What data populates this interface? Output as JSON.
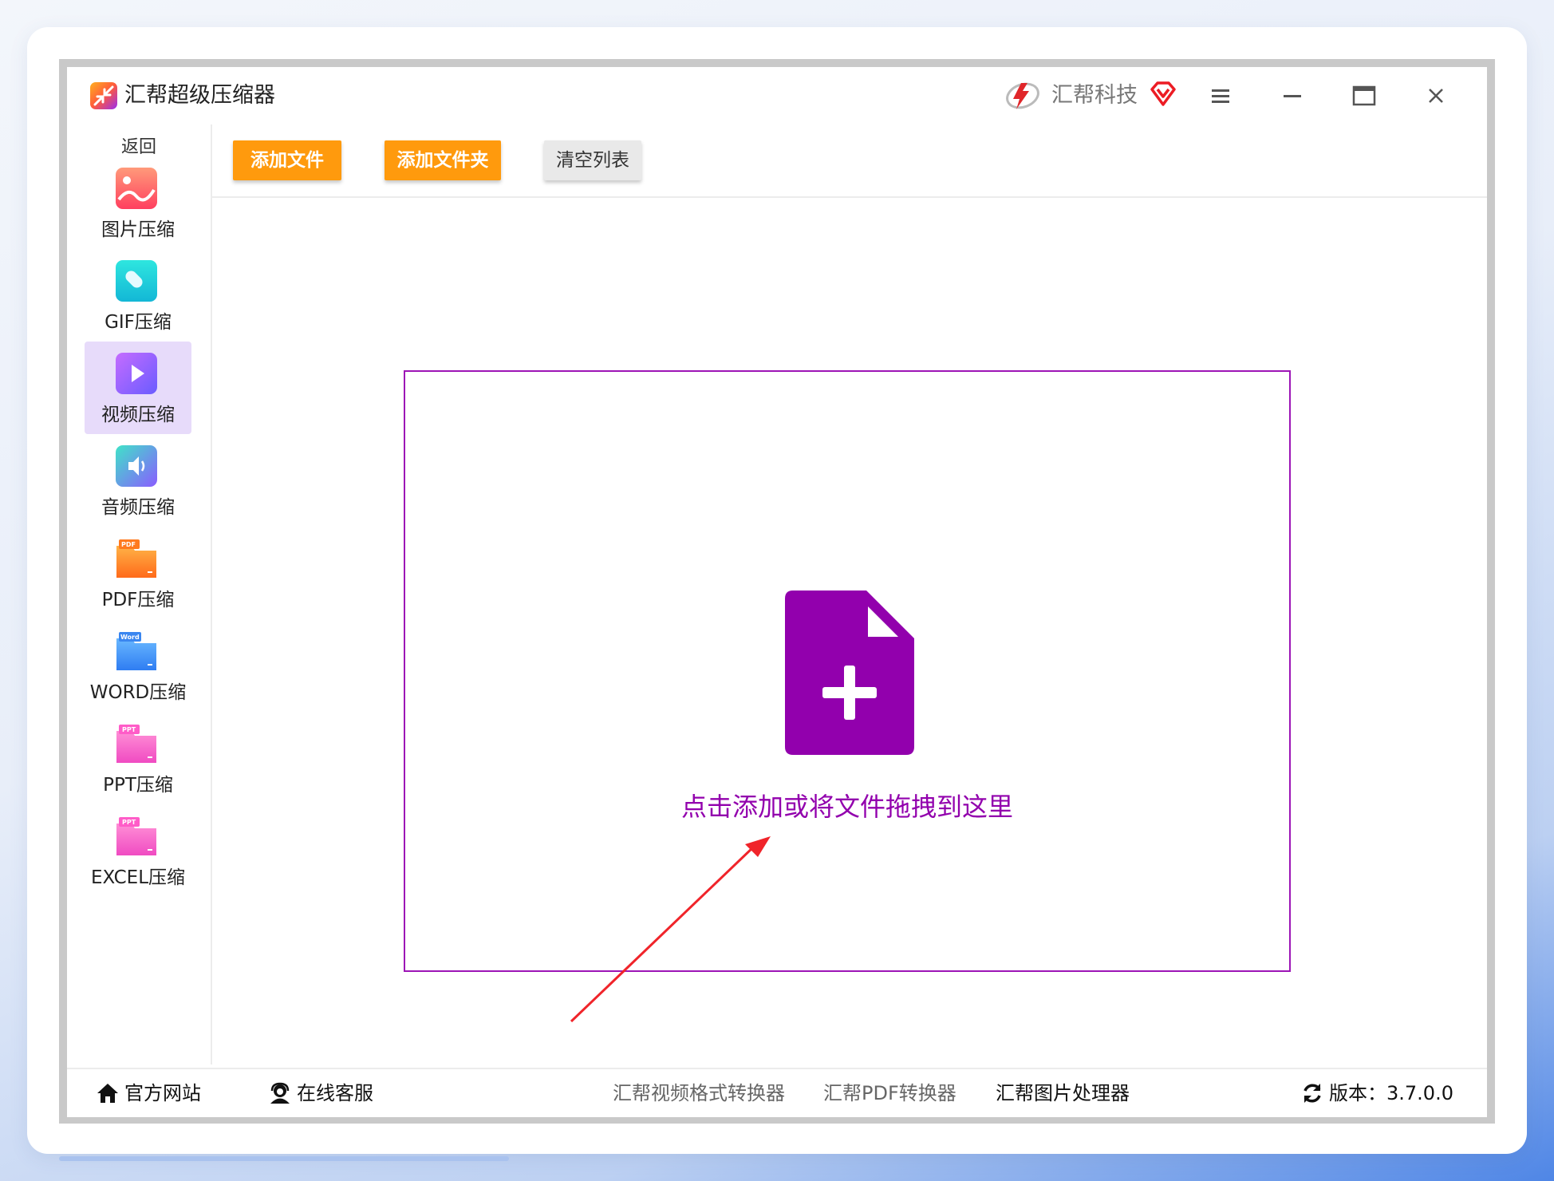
{
  "app": {
    "title": "汇帮超级压缩器",
    "brand": "汇帮科技"
  },
  "sidebar": {
    "back_label": "返回",
    "items": [
      {
        "label": "图片压缩",
        "icon": "image-compress-icon",
        "active": false
      },
      {
        "label": "GIF压缩",
        "icon": "gif-compress-icon",
        "active": false
      },
      {
        "label": "视频压缩",
        "icon": "video-compress-icon",
        "active": true
      },
      {
        "label": "音频压缩",
        "icon": "audio-compress-icon",
        "active": false
      },
      {
        "label": "PDF压缩",
        "icon": "pdf-compress-icon",
        "badge": "PDF",
        "active": false
      },
      {
        "label": "WORD压缩",
        "icon": "word-compress-icon",
        "badge": "Word",
        "active": false
      },
      {
        "label": "PPT压缩",
        "icon": "ppt-compress-icon",
        "badge": "PPT",
        "active": false
      },
      {
        "label": "EXCEL压缩",
        "icon": "excel-compress-icon",
        "badge": "PPT",
        "active": false
      }
    ]
  },
  "toolbar": {
    "add_file": "添加文件",
    "add_folder": "添加文件夹",
    "clear_list": "清空列表"
  },
  "dropzone": {
    "text": "点击添加或将文件拖拽到这里"
  },
  "statusbar": {
    "website": "官方网站",
    "support": "在线客服",
    "link1": "汇帮视频格式转换器",
    "link2": "汇帮PDF转换器",
    "link3": "汇帮图片处理器",
    "version": "版本：3.7.0.0"
  },
  "colors": {
    "accent_orange": "#ff9a0d",
    "drop_purple": "#9200ad",
    "active_nav": "#e7dbfa"
  }
}
